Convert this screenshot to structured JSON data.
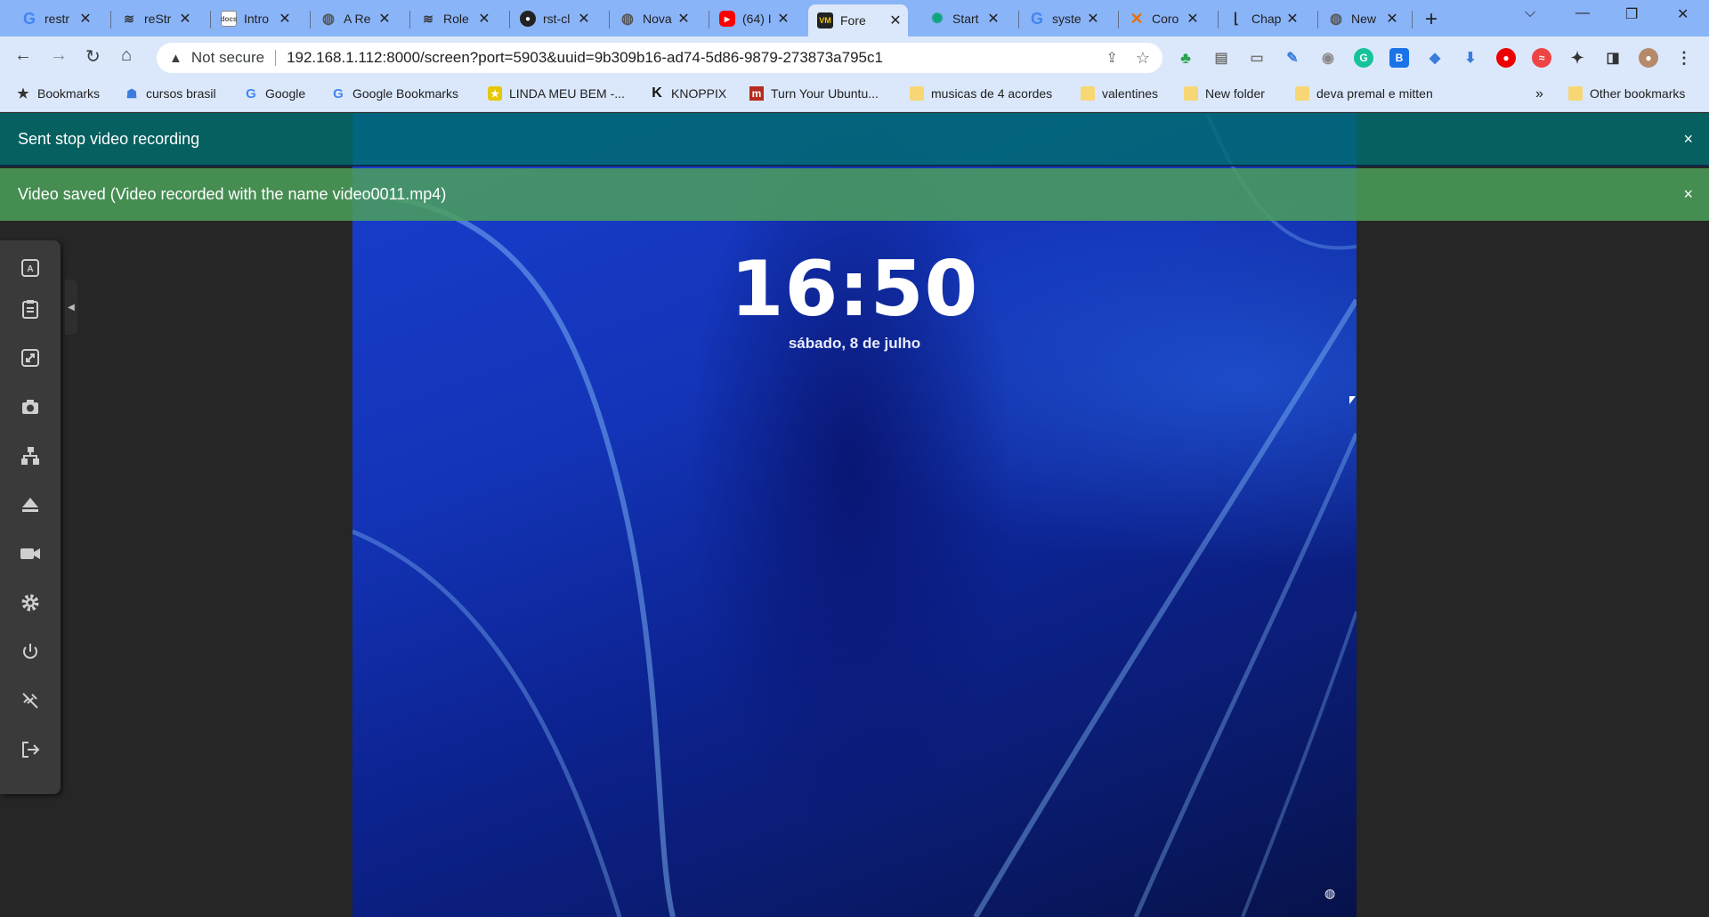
{
  "browser": {
    "tabs": [
      {
        "title": "restr",
        "favicon": "google-icon",
        "color": "#4285f4"
      },
      {
        "title": "reStr",
        "favicon": "hat-icon",
        "color": "#333333"
      },
      {
        "title": "Intro",
        "favicon": "docs-icon",
        "color": "#555555"
      },
      {
        "title": "A Re",
        "favicon": "globe-icon",
        "color": "#666666"
      },
      {
        "title": "Role",
        "favicon": "hat-icon",
        "color": "#333333"
      },
      {
        "title": "rst-cl",
        "favicon": "github-icon",
        "color": "#222222"
      },
      {
        "title": "Nova",
        "favicon": "globe-icon",
        "color": "#666666"
      },
      {
        "title": "(64) I",
        "favicon": "youtube-icon",
        "color": "#ff0000"
      },
      {
        "title": "Fore",
        "favicon": "vm-icon",
        "color": "#222222",
        "active": true
      },
      {
        "title": "Start",
        "favicon": "chatgpt-icon",
        "color": "#10a37f"
      },
      {
        "title": "syste",
        "favicon": "google-icon",
        "color": "#4285f4"
      },
      {
        "title": "Coro",
        "favicon": "x-logo-icon",
        "color": "#e8710a"
      },
      {
        "title": "Chap",
        "favicon": "bracket-icon",
        "color": "#333333"
      },
      {
        "title": "New",
        "favicon": "globe-icon",
        "color": "#666666"
      }
    ],
    "address": {
      "security": "Not secure",
      "url": "192.168.1.112:8000/screen?port=5903&uuid=9b309b16-ad74-5d86-9879-273873a795c1"
    },
    "bookmarks": [
      {
        "label": "Bookmarks",
        "icon": "star-icon"
      },
      {
        "label": "cursos brasil",
        "icon": "people-icon"
      },
      {
        "label": "Google",
        "icon": "google-icon"
      },
      {
        "label": "Google Bookmarks",
        "icon": "google-icon"
      },
      {
        "label": "LINDA MEU BEM -...",
        "icon": "star-badge-icon"
      },
      {
        "label": "KNOPPIX",
        "icon": "k-icon"
      },
      {
        "label": "Turn Your Ubuntu...",
        "icon": "m-icon"
      },
      {
        "label": "musicas de 4 acordes",
        "icon": "folder-icon"
      },
      {
        "label": "valentines",
        "icon": "folder-icon"
      },
      {
        "label": "New folder",
        "icon": "folder-icon"
      },
      {
        "label": "deva premal e mitten",
        "icon": "folder-icon"
      }
    ],
    "more_bookmarks": "»",
    "other_bookmarks": "Other bookmarks"
  },
  "notifications": [
    {
      "message": "Sent stop video recording",
      "close": "×"
    },
    {
      "message": "Video saved (Video recorded with the name video0011.mp4)",
      "close": "×"
    }
  ],
  "lockscreen": {
    "time": "16:50",
    "date": "sábado, 8 de julho"
  },
  "sidebar": [
    {
      "name": "keyboard-icon"
    },
    {
      "name": "clipboard-icon"
    },
    {
      "name": "fullscreen-icon"
    },
    {
      "name": "camera-icon"
    },
    {
      "name": "network-icon"
    },
    {
      "name": "eject-icon"
    },
    {
      "name": "video-camera-icon"
    },
    {
      "name": "settings-gear-icon"
    },
    {
      "name": "power-icon"
    },
    {
      "name": "disconnect-icon"
    },
    {
      "name": "logout-icon"
    }
  ]
}
